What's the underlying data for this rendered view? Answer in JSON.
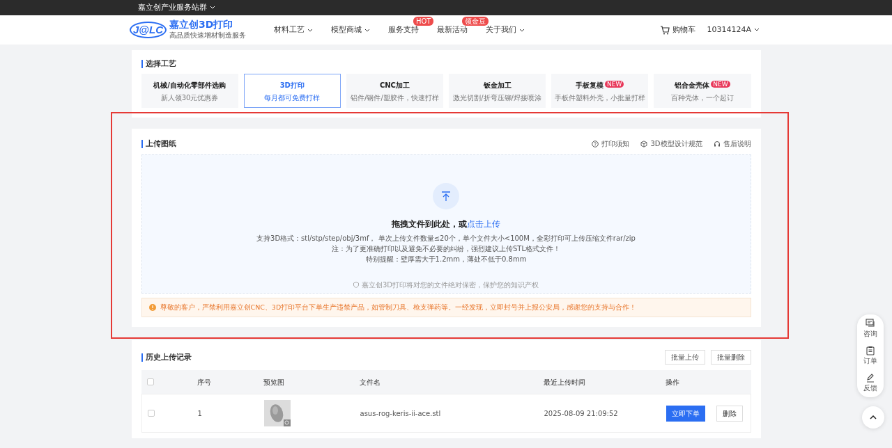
{
  "top_bar": {
    "label": "嘉立创产业服务站群"
  },
  "header": {
    "logo_mark": "J@LC",
    "logo_title": "嘉立创3D打印",
    "logo_subtitle": "高品质快速增材制造服务",
    "nav": [
      {
        "label": "材料工艺",
        "dropdown": true
      },
      {
        "label": "模型商城",
        "dropdown": true
      },
      {
        "label": "服务支持",
        "dropdown": false,
        "badge": "HOT"
      },
      {
        "label": "最新活动",
        "dropdown": false,
        "badge": "领金豆"
      },
      {
        "label": "关于我们",
        "dropdown": true
      }
    ],
    "cart": "购物车",
    "user": "10314124A"
  },
  "process": {
    "title": "选择工艺",
    "items": [
      {
        "title": "机械/自动化零部件选购",
        "subtitle": "新人领30元优惠券",
        "selected": false
      },
      {
        "title": "3D打印",
        "subtitle": "每月都可免费打样",
        "selected": true
      },
      {
        "title": "CNC加工",
        "subtitle": "铝件/钢件/塑胶件，快速打样",
        "selected": false
      },
      {
        "title": "钣金加工",
        "subtitle": "激光切割/折弯压铆/焊接喷涂",
        "selected": false
      },
      {
        "title": "手板复模",
        "subtitle": "手板件塑料外壳，小批量打样",
        "selected": false,
        "badge": "NEW"
      },
      {
        "title": "铝合金壳体",
        "subtitle": "百种壳体，一个起订",
        "selected": false,
        "badge": "NEW"
      }
    ]
  },
  "upload": {
    "title": "上传图纸",
    "links": [
      {
        "kind": "question",
        "label": "打印须知"
      },
      {
        "kind": "cube",
        "label": "3D模型设计规范"
      },
      {
        "kind": "headset",
        "label": "售后说明"
      }
    ],
    "drop_title": "拖拽文件到此处，或",
    "drop_link": "点击上传",
    "notes": [
      "支持3D格式：stl/stp/step/obj/3mf， 单次上传文件数量≤20个，单个文件大小<100M，全彩打印可上传压缩文件rar/zip",
      "注：为了更准确打印以及避免不必要的纠纷，强烈建议上传STL格式文件！",
      "特别提醒：壁厚需大于1.2mm，薄处不低于0.8mm"
    ],
    "privacy": "嘉立创3D打印将对您的文件绝对保密，保护您的知识产权",
    "warning": "尊敬的客户，严禁利用嘉立创CNC、3D打印平台下单生产违禁产品，如管制刀具、枪支弹药等。一经发现，立即封号并上报公安局，感谢您的支持与合作！",
    "highlighted": true
  },
  "history": {
    "title": "历史上传记录",
    "buttons": [
      "批量上传",
      "批量删除"
    ],
    "columns": [
      "序号",
      "预览图",
      "文件名",
      "最近上传时间",
      "操作"
    ],
    "all_checked": false,
    "rows": [
      {
        "checked": false,
        "number": "1",
        "preview": {
          "kind": "picture"
        },
        "file": "asus-rog-keris-ii-ace.stl",
        "time": "2025-08-09 21:09:52",
        "actions": [
          {
            "kind": "primary",
            "label": "立即下单"
          },
          {
            "kind": "plain",
            "label": "删除"
          }
        ]
      }
    ]
  },
  "side_panel": {
    "items": [
      {
        "kind": "chat",
        "label": "咨询"
      },
      {
        "kind": "clipboard",
        "label": "订单"
      },
      {
        "kind": "pen",
        "label": "反馈"
      }
    ]
  }
}
